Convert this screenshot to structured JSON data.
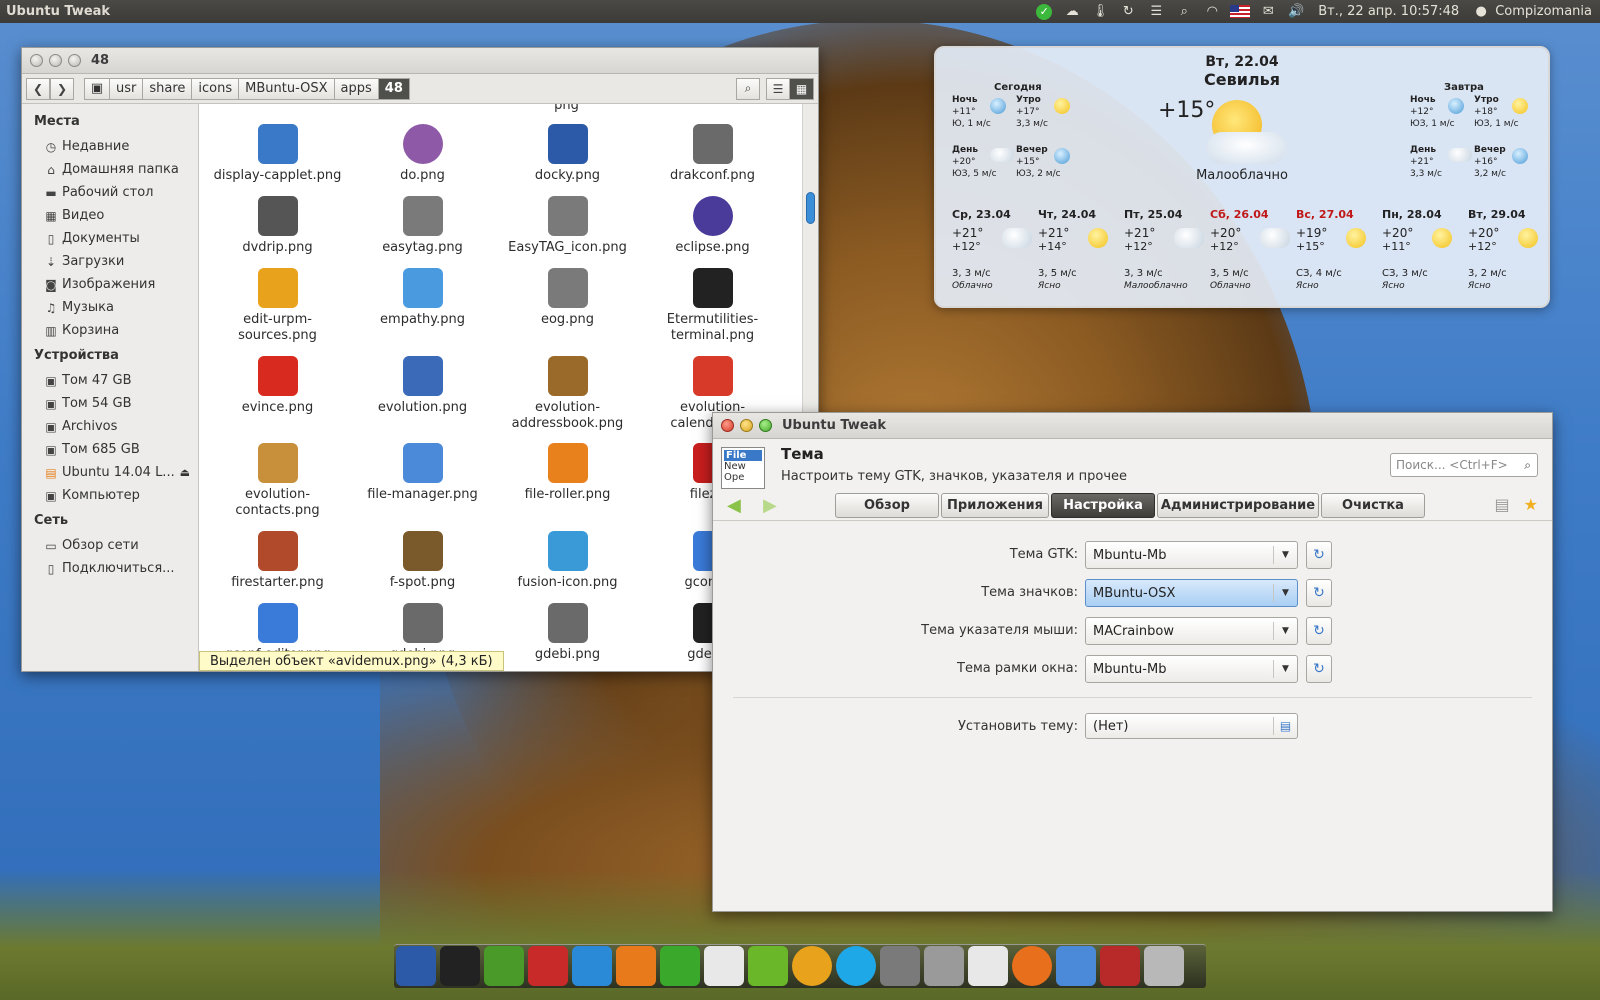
{
  "top_panel": {
    "app_title": "Ubuntu Tweak",
    "clock": "Вт., 22 апр. 10:57:48",
    "session_label": "Compizomania"
  },
  "file_manager": {
    "title": "48",
    "path": [
      "usr",
      "share",
      "icons",
      "MBuntu-OSX",
      "apps",
      "48"
    ],
    "sidebar": {
      "places_header": "Места",
      "places": [
        {
          "icon": "clock-icon",
          "label": "Недавние"
        },
        {
          "icon": "home-icon",
          "label": "Домашняя папка"
        },
        {
          "icon": "folder-icon",
          "label": "Рабочий стол"
        },
        {
          "icon": "film-icon",
          "label": "Видео"
        },
        {
          "icon": "document-icon",
          "label": "Документы"
        },
        {
          "icon": "download-icon",
          "label": "Загрузки"
        },
        {
          "icon": "camera-icon",
          "label": "Изображения"
        },
        {
          "icon": "music-icon",
          "label": "Музыка"
        },
        {
          "icon": "trash-icon",
          "label": "Корзина"
        }
      ],
      "devices_header": "Устройства",
      "devices": [
        {
          "icon": "drive-icon",
          "label": "Том 47 GB"
        },
        {
          "icon": "drive-icon",
          "label": "Том 54 GB"
        },
        {
          "icon": "drive-icon",
          "label": "Archivos"
        },
        {
          "icon": "drive-icon",
          "label": "Том 685 GB"
        },
        {
          "icon": "ubuntu-drive-icon",
          "label": "Ubuntu 14.04 L..."
        },
        {
          "icon": "computer-icon",
          "label": "Компьютер"
        }
      ],
      "network_header": "Сеть",
      "network": [
        {
          "icon": "network-icon",
          "label": "Обзор сети"
        },
        {
          "icon": "connect-icon",
          "label": "Подключиться..."
        }
      ]
    },
    "top_partial_file": "png",
    "files": [
      {
        "name": "display-capplet.png",
        "icon": "monitor-icon",
        "color": "#3a78c8"
      },
      {
        "name": "do.png",
        "icon": "gnome-do-icon",
        "color": "#8e5aa8"
      },
      {
        "name": "docky.png",
        "icon": "docky-icon",
        "color": "#2d5aa8"
      },
      {
        "name": "drakconf.png",
        "icon": "gear-icon",
        "color": "#6a6a6a"
      },
      {
        "name": "dvdrip.png",
        "icon": "dvd-icon",
        "color": "#555555"
      },
      {
        "name": "easytag.png",
        "icon": "cd-icon",
        "color": "#7a7a7a"
      },
      {
        "name": "EasyTAG_icon.png",
        "icon": "cd-icon",
        "color": "#7a7a7a"
      },
      {
        "name": "eclipse.png",
        "icon": "eclipse-icon",
        "color": "#4a3a9a"
      },
      {
        "name": "edit-urpm-sources.png",
        "icon": "magnifier-icon",
        "color": "#e8a21c"
      },
      {
        "name": "empathy.png",
        "icon": "chat-bubble-icon",
        "color": "#4a9ae0"
      },
      {
        "name": "eog.png",
        "icon": "image-viewer-icon",
        "color": "#7a7a7a"
      },
      {
        "name": "Etermutilities-terminal.png",
        "icon": "terminal-icon",
        "color": "#222222"
      },
      {
        "name": "evince.png",
        "icon": "pdf-icon",
        "color": "#d82a1e"
      },
      {
        "name": "evolution.png",
        "icon": "mail-icon",
        "color": "#3a6ab8"
      },
      {
        "name": "evolution-addressbook.png",
        "icon": "address-book-icon",
        "color": "#9a6a2a"
      },
      {
        "name": "evolution-calendar.png",
        "icon": "calendar-icon",
        "color": "#d83a2a"
      },
      {
        "name": "evolution-contacts.png",
        "icon": "address-book-icon",
        "color": "#c8903a"
      },
      {
        "name": "file-manager.png",
        "icon": "finder-icon",
        "color": "#4a8ad8"
      },
      {
        "name": "file-roller.png",
        "icon": "archive-icon",
        "color": "#e8801c"
      },
      {
        "name": "filezilla",
        "icon": "filezilla-icon",
        "color": "#c81e1e"
      },
      {
        "name": "firestarter.png",
        "icon": "brick-wall-icon",
        "color": "#b04a2a"
      },
      {
        "name": "f-spot.png",
        "icon": "camera-icon",
        "color": "#7a5a2a"
      },
      {
        "name": "fusion-icon.png",
        "icon": "cursor-icon",
        "color": "#3a9ad8"
      },
      {
        "name": "gconfedi",
        "icon": "tools-icon",
        "color": "#3a7ad8"
      },
      {
        "name": "gconf-editor.png",
        "icon": "hammer-icon",
        "color": "#3a7ad8"
      },
      {
        "name": "gdebi.png",
        "icon": "download-drive-icon",
        "color": "#6a6a6a"
      },
      {
        "name": "gdebi.png",
        "icon": "download-drive-icon",
        "color": "#6a6a6a"
      },
      {
        "name": "gdeskle",
        "icon": "gauge-icon",
        "color": "#222222"
      }
    ],
    "status": "Выделен объект «avidemux.png» (4,3 кБ)"
  },
  "weather": {
    "date": "Вт, 22.04",
    "city": "Севилья",
    "current_temp": "+15°",
    "condition": "Малооблачно",
    "today": {
      "header": "Сегодня",
      "slots": [
        {
          "name": "Ночь",
          "temp": "+11°",
          "wind": "Ю, 1 м/с",
          "icon": "moon-icon"
        },
        {
          "name": "Утро",
          "temp": "+17°",
          "wind": "3,3 м/с",
          "icon": "sun-icon"
        },
        {
          "name": "День",
          "temp": "+20°",
          "wind": "ЮЗ, 5 м/с",
          "icon": "cloud-sun-icon"
        },
        {
          "name": "Вечер",
          "temp": "+15°",
          "wind": "ЮЗ, 2 м/с",
          "icon": "moon-icon"
        }
      ]
    },
    "tomorrow": {
      "header": "Завтра",
      "slots": [
        {
          "name": "Ночь",
          "temp": "+12°",
          "wind": "ЮЗ, 1 м/с",
          "icon": "moon-icon"
        },
        {
          "name": "Утро",
          "temp": "+18°",
          "wind": "ЮЗ, 1 м/с",
          "icon": "sun-icon"
        },
        {
          "name": "День",
          "temp": "+21°",
          "wind": "3,3 м/с",
          "icon": "cloud-sun-icon"
        },
        {
          "name": "Вечер",
          "temp": "+16°",
          "wind": "3,2 м/с",
          "icon": "moon-icon"
        }
      ]
    },
    "forecast": [
      {
        "day": "Ср, 23.04",
        "weekend": false,
        "hi": "+21°",
        "lo": "+12°",
        "wind": "3, 3 м/с",
        "cond": "Облачно",
        "icon": "cloud-sun-icon"
      },
      {
        "day": "Чт, 24.04",
        "weekend": false,
        "hi": "+21°",
        "lo": "+14°",
        "wind": "3, 5 м/с",
        "cond": "Ясно",
        "icon": "sun-icon"
      },
      {
        "day": "Пт, 25.04",
        "weekend": false,
        "hi": "+21°",
        "lo": "+12°",
        "wind": "3, 3 м/с",
        "cond": "Малооблачно",
        "icon": "cloud-sun-icon"
      },
      {
        "day": "Сб, 26.04",
        "weekend": true,
        "hi": "+20°",
        "lo": "+12°",
        "wind": "3, 5 м/с",
        "cond": "Облачно",
        "icon": "cloud-sun-icon"
      },
      {
        "day": "Вс, 27.04",
        "weekend": true,
        "hi": "+19°",
        "lo": "+15°",
        "wind": "СЗ, 4 м/с",
        "cond": "Ясно",
        "icon": "sun-icon"
      },
      {
        "day": "Пн, 28.04",
        "weekend": false,
        "hi": "+20°",
        "lo": "+11°",
        "wind": "СЗ, 3 м/с",
        "cond": "Ясно",
        "icon": "sun-icon"
      },
      {
        "day": "Вт, 29.04",
        "weekend": false,
        "hi": "+20°",
        "lo": "+12°",
        "wind": "3, 2 м/с",
        "cond": "Ясно",
        "icon": "sun-icon"
      }
    ]
  },
  "tweak": {
    "window_title": "Ubuntu Tweak",
    "app_icon_lines": [
      "File",
      "New",
      "Ope"
    ],
    "section_title": "Тема",
    "section_subtitle": "Настроить тему GTK, значков, указателя и прочее",
    "search_placeholder": "Поиск... <Ctrl+F>",
    "tabs": [
      "Обзор",
      "Приложения",
      "Настройка",
      "Администрирование",
      "Очистка"
    ],
    "active_tab": "Настройка",
    "settings": [
      {
        "label": "Тема GTK:",
        "value": "Mbuntu-Mb",
        "active": false
      },
      {
        "label": "Тема значков:",
        "value": "MBuntu-OSX",
        "active": true
      },
      {
        "label": "Тема указателя мыши:",
        "value": "MACrainbow",
        "active": false
      },
      {
        "label": "Тема рамки окна:",
        "value": "Mbuntu-Mb",
        "active": false
      }
    ],
    "install_label": "Установить тему:",
    "install_value": "(Нет)"
  },
  "dock": {
    "items": [
      {
        "icon": "docky-icon",
        "color": "#2d5aa8"
      },
      {
        "icon": "terminal-icon",
        "color": "#222222"
      },
      {
        "icon": "settings-gear-icon",
        "color": "#4a9a2a"
      },
      {
        "icon": "checkmark-search-icon",
        "color": "#c82a2a"
      },
      {
        "icon": "writer-icon",
        "color": "#2a8ad8"
      },
      {
        "icon": "impress-icon",
        "color": "#e87a1c"
      },
      {
        "icon": "calc-icon",
        "color": "#3aa82a"
      },
      {
        "icon": "text-editor-icon",
        "color": "#e8e8e8"
      },
      {
        "icon": "media-player-icon",
        "color": "#6ab82a"
      },
      {
        "icon": "chrome-icon",
        "color": "#e8a21c"
      },
      {
        "icon": "skype-icon",
        "color": "#1ea8e8"
      },
      {
        "icon": "screenshot-icon",
        "color": "#7a7a7a"
      },
      {
        "icon": "mixer-icon",
        "color": "#9a9a9a"
      },
      {
        "icon": "mail-icon",
        "color": "#e8e8e8"
      },
      {
        "icon": "firefox-icon",
        "color": "#e8701c"
      },
      {
        "icon": "finder-icon",
        "color": "#4a8ad8"
      },
      {
        "icon": "photo-icon",
        "color": "#b82a2a"
      },
      {
        "icon": "trash-icon",
        "color": "#b8b8b8"
      }
    ]
  }
}
